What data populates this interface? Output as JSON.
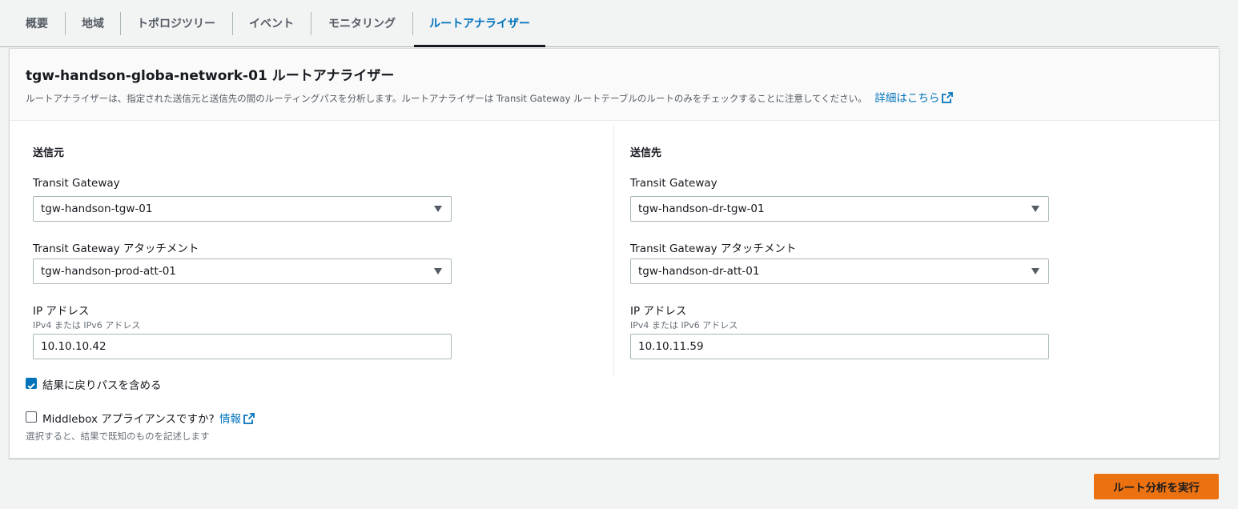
{
  "tabs": [
    {
      "label": "概要"
    },
    {
      "label": "地域"
    },
    {
      "label": "トポロジツリー"
    },
    {
      "label": "イベント"
    },
    {
      "label": "モニタリング"
    },
    {
      "label": "ルートアナライザー",
      "active": true
    }
  ],
  "panel": {
    "title": "tgw-handson-globa-network-01 ルートアナライザー",
    "description": "ルートアナライザーは、指定された送信元と送信先の間のルーティングパスを分析します。ルートアナライザーは Transit Gateway ルートテーブルのルートのみをチェックすることに注意してください。",
    "details_link": "詳細はこちら"
  },
  "source": {
    "heading": "送信元",
    "tgw_label": "Transit Gateway",
    "tgw_value": "tgw-handson-tgw-01",
    "attachment_label": "Transit Gateway アタッチメント",
    "attachment_value": "tgw-handson-prod-att-01",
    "ip_label": "IP アドレス",
    "ip_sublabel": "IPv4 または IPv6 アドレス",
    "ip_value": "10.10.10.42"
  },
  "destination": {
    "heading": "送信先",
    "tgw_label": "Transit Gateway",
    "tgw_value": "tgw-handson-dr-tgw-01",
    "attachment_label": "Transit Gateway アタッチメント",
    "attachment_value": "tgw-handson-dr-att-01",
    "ip_label": "IP アドレス",
    "ip_sublabel": "IPv4 または IPv6 アドレス",
    "ip_value": "10.10.11.59"
  },
  "options": {
    "return_path_label": "結果に戻りパスを含める",
    "return_path_checked": true,
    "middlebox_label": "Middlebox アプライアンスですか?",
    "middlebox_checked": false,
    "middlebox_info_link": "情報",
    "middlebox_hint": "選択すると、結果で既知のものを記述します"
  },
  "actions": {
    "run_label": "ルート分析を実行"
  },
  "colors": {
    "accent": "#0073bb",
    "primary_button": "#ec7211"
  }
}
